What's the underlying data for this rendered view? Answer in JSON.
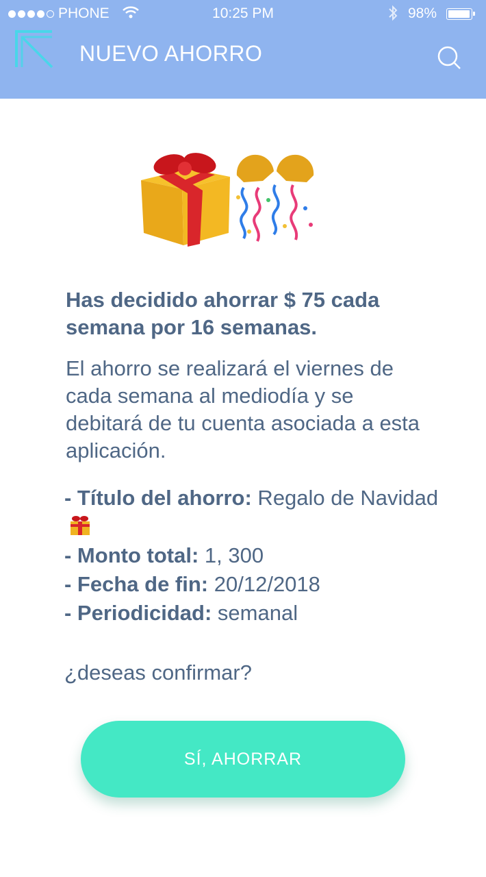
{
  "status_bar": {
    "carrier": "PHONE",
    "time": "10:25 PM",
    "battery": "98%"
  },
  "header": {
    "title": "NUEVO AHORRO",
    "back_icon": "back-arrow-icon",
    "search_icon": "search-icon",
    "background": "#8fb4ef"
  },
  "illustration": {
    "icons": [
      "gift-icon",
      "party-popper-icon"
    ]
  },
  "summary": {
    "headline": "Has decidido ahorrar $ 75 cada semana por 16 semanas.",
    "description": "El ahorro se realizará el viernes de cada semana al mediodía y se debitará de tu cuenta asociada a esta aplicación."
  },
  "details": {
    "title_label": "- Título del ahorro:",
    "title_value": " Regalo de Navidad",
    "amount_label": "- Monto total:",
    "amount_value": " 1, 300",
    "end_date_label": "- Fecha de fin:",
    "end_date_value": " 20/12/2018",
    "period_label": "- Periodicidad:",
    "period_value": " semanal"
  },
  "question": "¿deseas confirmar?",
  "cta": {
    "label": "SÍ, AHORRAR",
    "color": "#44e8c5"
  },
  "colors": {
    "text": "#4f6785",
    "accent": "#44e8c5",
    "header": "#8fb4ef",
    "back_icon": "#49d6e9"
  }
}
